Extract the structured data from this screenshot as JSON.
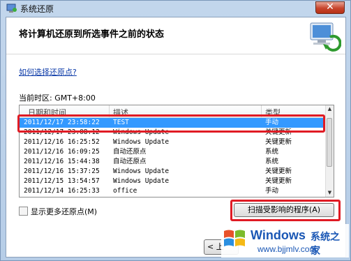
{
  "window": {
    "title": "系统还原",
    "close_glyph": "✕"
  },
  "header": {
    "title": "将计算机还原到所选事件之前的状态",
    "icon": "system-restore-icon"
  },
  "help_link": "如何选择还原点?",
  "timezone": "当前时区: GMT+8:00",
  "columns": [
    "日期和时间",
    "描述",
    "类型"
  ],
  "rows": [
    {
      "datetime": "2011/12/17 23:58:22",
      "description": "TEST",
      "type": "手动",
      "selected": true
    },
    {
      "datetime": "2011/12/17 23:08:12",
      "description": "Windows Update",
      "type": "关键更新"
    },
    {
      "datetime": "2011/12/16 16:25:52",
      "description": "Windows Update",
      "type": "关键更新"
    },
    {
      "datetime": "2011/12/16 16:09:25",
      "description": "自动还原点",
      "type": "系统"
    },
    {
      "datetime": "2011/12/16 15:44:38",
      "description": "自动还原点",
      "type": "系统"
    },
    {
      "datetime": "2011/12/16 15:37:25",
      "description": "Windows Update",
      "type": "关键更新"
    },
    {
      "datetime": "2011/12/15 13:54:57",
      "description": "Windows Update",
      "type": "关键更新"
    },
    {
      "datetime": "2011/12/14 16:25:33",
      "description": "office",
      "type": "手动"
    }
  ],
  "show_more_label": "显示更多还原点(M)",
  "scan_button": "扫描受影响的程序(A)",
  "back_button": "< 上",
  "watermark": {
    "brand": "Windows",
    "brand_cn": "系统之家",
    "url": "www.bjjmlv.com"
  },
  "accent_colors": {
    "selection": "#3399ff",
    "highlight_box": "#e01b24",
    "link": "#0b3aa8"
  }
}
